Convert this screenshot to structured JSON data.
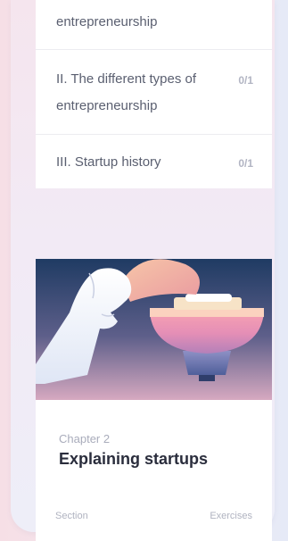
{
  "sections": [
    {
      "label": "entrepreneurship",
      "count": ""
    },
    {
      "label": "II. The different types of entrepreneurship",
      "count": "0/1"
    },
    {
      "label": "III. Startup history",
      "count": "0/1"
    }
  ],
  "chapter": {
    "label": "Chapter 2",
    "title": "Explaining startups",
    "section_label": "Section",
    "exercises_label": "Exercises"
  }
}
